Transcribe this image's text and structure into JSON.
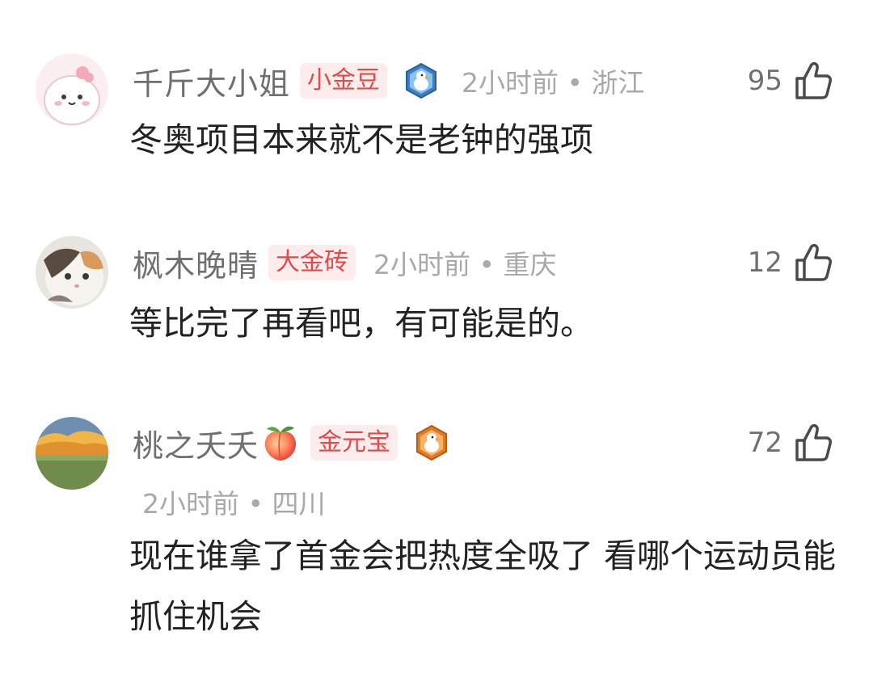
{
  "comments": [
    {
      "username": "千斤大小姐",
      "badge": "小金豆",
      "time": "2小时前",
      "location": "浙江",
      "likes": "95",
      "text": "冬奥项目本来就不是老钟的强项"
    },
    {
      "username": "枫木晚晴",
      "badge": "大金砖",
      "time": "2小时前",
      "location": "重庆",
      "likes": "12",
      "text": "等比完了再看吧，有可能是的。"
    },
    {
      "username": "桃之夭夭",
      "badge": "金元宝",
      "time": "2小时前",
      "location": "四川",
      "likes": "72",
      "text": "现在谁拿了首金会把热度全吸了 看哪个运动员能抓住机会"
    }
  ],
  "separator": "•",
  "colors": {
    "badge_text": "#e24a4a",
    "badge_bg": "#fdecec",
    "username": "#6f6f6f",
    "meta": "#a9a9a9",
    "content": "#222222"
  },
  "icons": {
    "like": "thumbs-up-outline-icon",
    "medal_1": "duck-medal-blue-icon",
    "medal_3": "duck-medal-orange-icon",
    "emoji_3": "peach-emoji"
  }
}
